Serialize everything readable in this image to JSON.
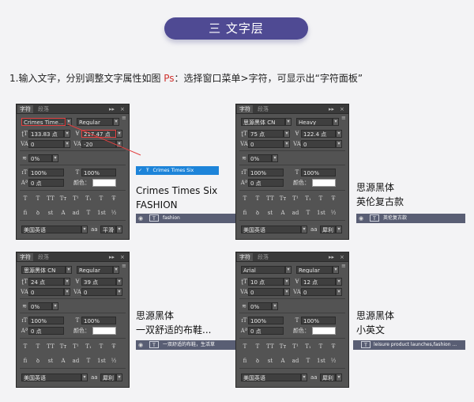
{
  "header": {
    "title": "三 文字层"
  },
  "instruction": {
    "prefix": "1.输入文字，分别调整文字属性如图 ",
    "ps": "Ps",
    "suffix": "：选择窗口菜单>字符，可显示出“字符面板”"
  },
  "panel_common": {
    "tab_character": "字符",
    "tab_paragraph": "段落",
    "collapse_glyph": "▸▸",
    "close_glyph": "×",
    "menu_glyph": "≡",
    "color_label": "颜色：",
    "scale_value": "100%",
    "baseline_value": "0 点",
    "language": "美国英语",
    "dropdown_arrow": "▾",
    "format_buttons": [
      "T",
      "T",
      "TT",
      "Tт",
      "T¹",
      "T₁",
      "T",
      "Ŧ"
    ],
    "opentype_buttons": [
      "fi",
      "ꝺ",
      "st",
      "A",
      "ad",
      "T",
      "1st",
      "½"
    ]
  },
  "panels": [
    {
      "font": "Crimes Time...",
      "style": "Regular",
      "size": "133.83 点",
      "leading": "217.47 点",
      "kerning": "0",
      "tracking": "-20",
      "tsume": "0%",
      "antialias": "平滑"
    },
    {
      "font": "思源黑体 CN",
      "style": "Heavy",
      "size": "75 点",
      "leading": "122.4 点",
      "kerning": "0",
      "tracking": "0",
      "tsume": "0%",
      "antialias": "犀利"
    },
    {
      "font": "思源黑体 CN",
      "style": "Regular",
      "size": "24 点",
      "leading": "39 点",
      "kerning": "0",
      "tracking": "0",
      "tsume": "0%",
      "antialias": "犀利"
    },
    {
      "font": "Arial",
      "style": "Regular",
      "size": "10 点",
      "leading": "12 点",
      "kerning": "0",
      "tracking": "0",
      "tsume": "0%",
      "antialias": "犀利"
    }
  ],
  "font_popup": {
    "check": "✓",
    "icon": "Ŧ",
    "label": "Crimes Times Six"
  },
  "annotations": [
    {
      "line1": "Crimes Times Six",
      "line2": "FASHION",
      "layer": "fashion"
    },
    {
      "line1": "思源黑体",
      "line2": "英伦复古款",
      "layer": "英伦复古款"
    },
    {
      "line1": "思源黑体",
      "line2": "一双舒适的布鞋...",
      "layer": "一双舒适的布鞋，生活草"
    },
    {
      "line1": "思源黑体",
      "line2": "小英文",
      "layer": "leisure product launches,fashion ..."
    }
  ],
  "layer_icons": {
    "eye": "◉",
    "text_layer": "T"
  },
  "colors": {
    "accent": "#4f4a93",
    "panel_bg": "#535353",
    "layer_bar": "#595e74",
    "popup": "#1d84d9",
    "highlight": "#e24040"
  }
}
